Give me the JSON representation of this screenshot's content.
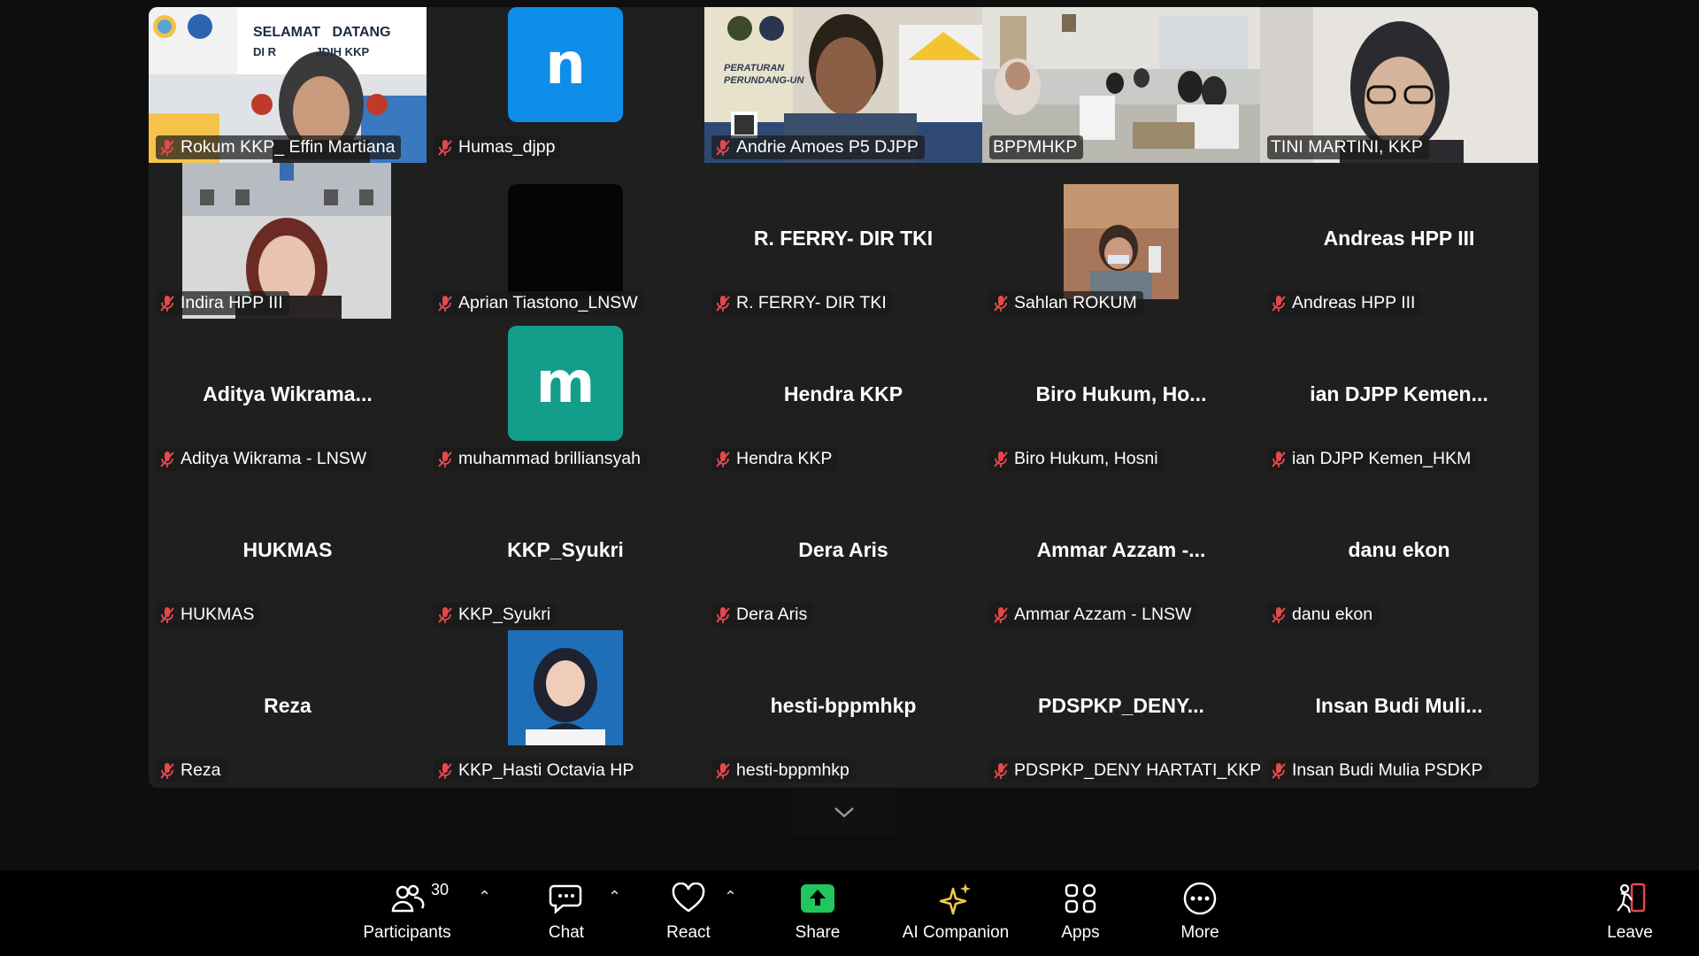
{
  "tiles": [
    {
      "name": "Rokum KKP_ Effin Martiana",
      "banner": [
        "SELAMAT",
        "DATANG",
        "DI R",
        "JDIH KKP"
      ],
      "type": "video"
    },
    {
      "name": "Humas_djpp",
      "type": "avatar",
      "letter": "n",
      "color": "#0e8ee8"
    },
    {
      "name": "Andrie Amoes P5 DJPP",
      "banner": [
        "PERATURAN",
        "PERUNDANG-UN"
      ],
      "type": "video"
    },
    {
      "name": "BPPMHKP",
      "type": "video",
      "active": true
    },
    {
      "name": "TINI MARTINI, KKP",
      "type": "video"
    },
    {
      "name": "Indira HPP III",
      "type": "video"
    },
    {
      "name": "Aprian Tiastono_LNSW",
      "type": "black"
    },
    {
      "name": "R. FERRY- DIR TKI",
      "display": "R. FERRY- DIR TKI",
      "type": "text"
    },
    {
      "name": "Sahlan ROKUM",
      "type": "video"
    },
    {
      "name": "Andreas HPP III",
      "display": "Andreas HPP III",
      "type": "text"
    },
    {
      "name": "Aditya Wikrama - LNSW",
      "display": "Aditya  Wikrama...",
      "type": "text"
    },
    {
      "name": "muhammad brilliansyah",
      "type": "avatar",
      "letter": "m",
      "color": "#139e8b"
    },
    {
      "name": "Hendra KKP",
      "display": "Hendra KKP",
      "type": "text"
    },
    {
      "name": "Biro Hukum, Hosni",
      "display": "Biro  Hukum,  Ho...",
      "type": "text"
    },
    {
      "name": "ian DJPP Kemen_HKM",
      "display": "ian  DJPP  Kemen...",
      "type": "text"
    },
    {
      "name": "HUKMAS",
      "display": "HUKMAS",
      "type": "text"
    },
    {
      "name": "KKP_Syukri",
      "display": "KKP_Syukri",
      "type": "text"
    },
    {
      "name": "Dera Aris",
      "display": "Dera Aris",
      "type": "text"
    },
    {
      "name": "Ammar Azzam - LNSW",
      "display": "Ammar  Azzam  -...",
      "type": "text"
    },
    {
      "name": "danu ekon",
      "display": "danu ekon",
      "type": "text"
    },
    {
      "name": "Reza",
      "display": "Reza",
      "type": "text"
    },
    {
      "name": "KKP_Hasti Octavia HP",
      "type": "video"
    },
    {
      "name": "hesti-bppmhkp",
      "display": "hesti-bppmhkp",
      "type": "text"
    },
    {
      "name": "PDSPKP_DENY HARTATI_KKP",
      "display": "PDSPKP_DENY...",
      "type": "text"
    },
    {
      "name": "Insan Budi Mulia PSDKP",
      "display": "Insan  Budi  Muli...",
      "type": "text"
    }
  ],
  "toolbar": {
    "participants_label": "Participants",
    "participants_count": "30",
    "chat_label": "Chat",
    "react_label": "React",
    "share_label": "Share",
    "ai_label": "AI Companion",
    "apps_label": "Apps",
    "more_label": "More",
    "leave_label": "Leave"
  },
  "colors": {
    "active_border": "#23d959",
    "share_green": "#22c55e",
    "mute_red": "#e5484d"
  }
}
